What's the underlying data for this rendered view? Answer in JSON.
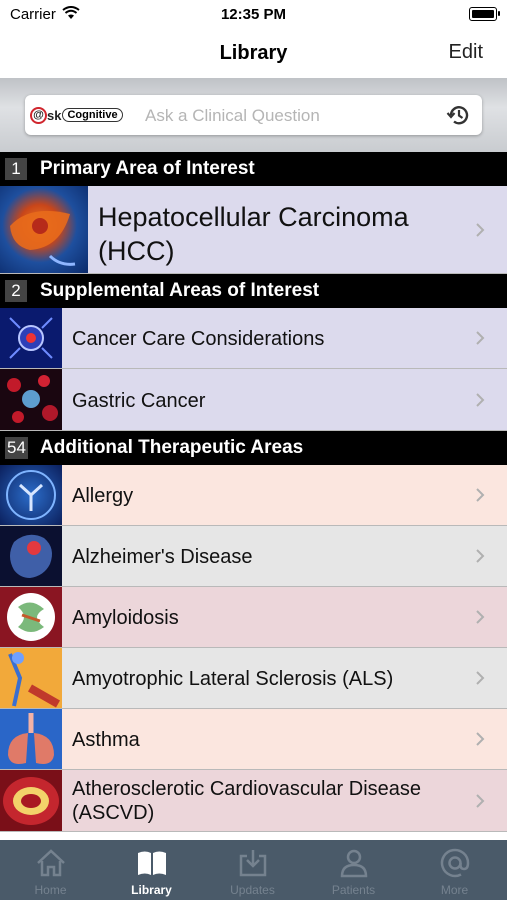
{
  "status": {
    "carrier": "Carrier",
    "time": "12:35 PM"
  },
  "navbar": {
    "title": "Library",
    "edit_label": "Edit"
  },
  "search": {
    "logo_prefix": "@",
    "logo_suffix": "sk",
    "logo_badge": "Cognitive",
    "placeholder": "Ask a Clinical Question"
  },
  "sections": {
    "primary": {
      "count": "1",
      "title": "Primary Area of Interest"
    },
    "supplemental": {
      "count": "2",
      "title": "Supplemental Areas of Interest"
    },
    "additional": {
      "count": "54",
      "title": "Additional Therapeutic Areas"
    }
  },
  "primary_item": {
    "label_line1": "Hepatocellular Carcinoma",
    "label_line2": "(HCC)"
  },
  "supplemental_items": [
    {
      "label": "Cancer Care Considerations"
    },
    {
      "label": "Gastric Cancer"
    }
  ],
  "additional_items": [
    {
      "label": "Allergy"
    },
    {
      "label": "Alzheimer's Disease"
    },
    {
      "label": "Amyloidosis"
    },
    {
      "label": "Amyotrophic Lateral Sclerosis (ALS)"
    },
    {
      "label": "Asthma"
    },
    {
      "label_line1": "Atherosclerotic Cardiovascular Disease",
      "label_line2": "(ASCVD)"
    }
  ],
  "tabs": [
    {
      "label": "Home",
      "icon": "home-icon"
    },
    {
      "label": "Library",
      "icon": "book-icon"
    },
    {
      "label": "Updates",
      "icon": "download-icon"
    },
    {
      "label": "Patients",
      "icon": "person-icon"
    },
    {
      "label": "More",
      "icon": "at-icon"
    }
  ],
  "colors": {
    "section_bg": "#000000",
    "primary_row_bg": "#dcdaed",
    "row_pink": "#fbe6df",
    "row_gray": "#e6e6e6",
    "row_rose": "#ecd6da",
    "tabbar_bg": "#4a5a69"
  }
}
